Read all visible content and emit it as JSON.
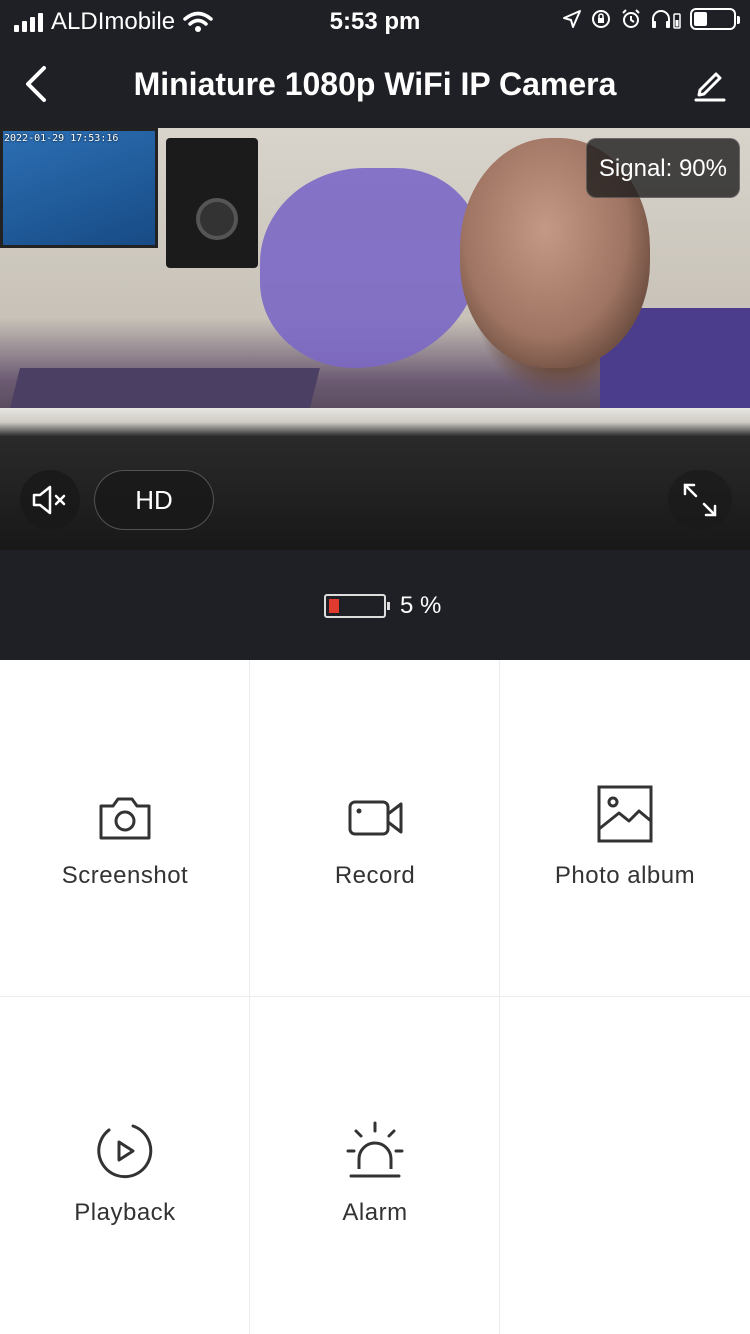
{
  "status_bar": {
    "carrier": "ALDImobile",
    "time": "5:53 pm"
  },
  "nav": {
    "title": "Miniature 1080p WiFi IP Camera"
  },
  "camera": {
    "timestamp": "2022-01-29 17:53:16",
    "signal_text": "Signal: 90%",
    "quality_label": "HD"
  },
  "battery": {
    "level_percent": 5,
    "text": "5 %",
    "fill_color": "#e13a2e"
  },
  "actions": [
    {
      "label": "Screenshot",
      "icon": "camera-icon"
    },
    {
      "label": "Record",
      "icon": "video-camera-icon"
    },
    {
      "label": "Photo album",
      "icon": "image-icon"
    },
    {
      "label": "Playback",
      "icon": "play-circle-icon"
    },
    {
      "label": "Alarm",
      "icon": "siren-icon"
    }
  ],
  "colors": {
    "header_bg": "#1f2026",
    "text_dark": "#333333",
    "grid_divider": "#ececec"
  }
}
